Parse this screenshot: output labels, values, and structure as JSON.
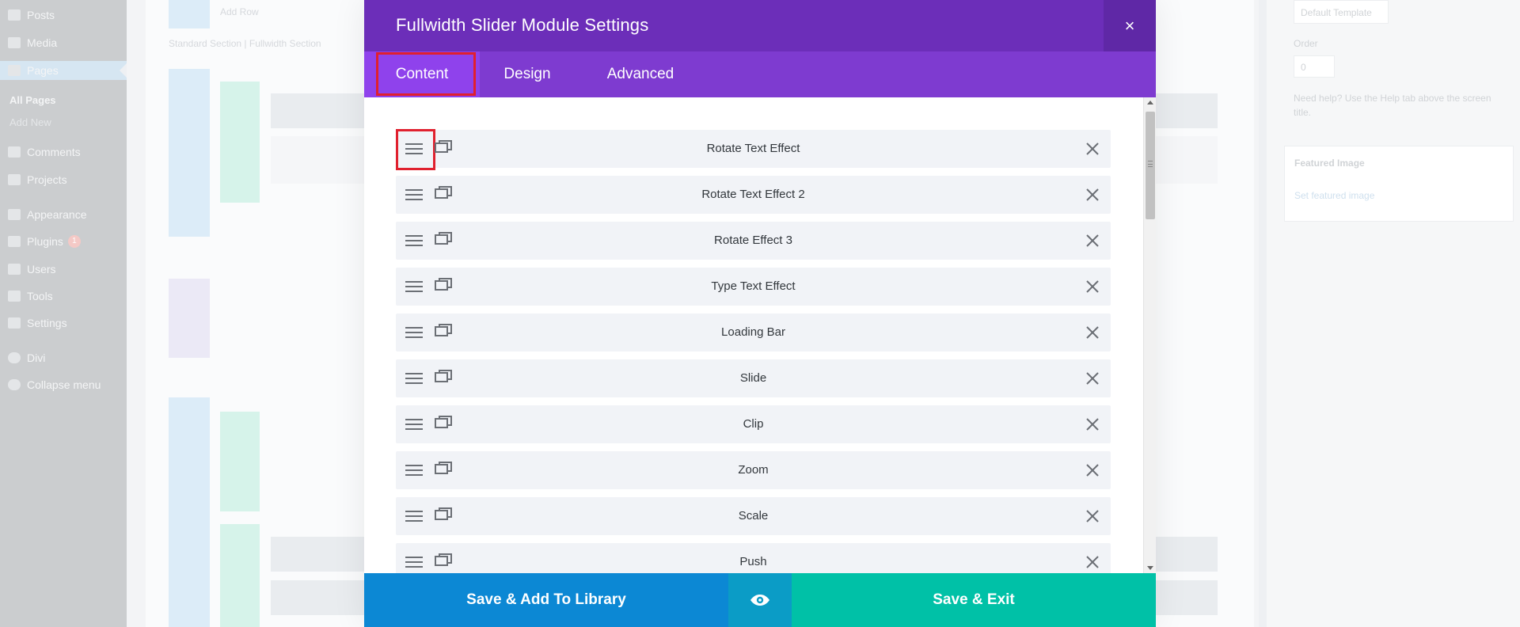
{
  "sidebar": {
    "items": [
      {
        "label": "Posts",
        "icon": "pin-icon"
      },
      {
        "label": "Media",
        "icon": "media-icon"
      },
      {
        "label": "Pages",
        "icon": "pages-icon"
      },
      {
        "label": "All Pages"
      },
      {
        "label": "Add New"
      },
      {
        "label": "Comments",
        "icon": "comment-icon"
      },
      {
        "label": "Projects",
        "icon": "pin-icon"
      },
      {
        "label": "Appearance",
        "icon": "brush-icon"
      },
      {
        "label": "Plugins",
        "icon": "plug-icon",
        "badge": "1"
      },
      {
        "label": "Users",
        "icon": "user-icon"
      },
      {
        "label": "Tools",
        "icon": "wrench-icon"
      },
      {
        "label": "Settings",
        "icon": "settings-icon"
      },
      {
        "label": "Divi",
        "icon": "divi-icon"
      },
      {
        "label": "Collapse menu",
        "icon": "collapse-icon"
      }
    ]
  },
  "builder_bg": {
    "add_row": "Add Row",
    "standard_section": "Standard Section",
    "separator": "|",
    "fullwidth_section": "Fullwidth Section"
  },
  "right_panel": {
    "template_value": "Default Template",
    "order_label": "Order",
    "order_value": "0",
    "help_text": "Need help? Use the Help tab above the screen title.",
    "featured_image": "Featured Image",
    "set_featured_image": "Set featured image"
  },
  "modal": {
    "title": "Fullwidth Slider Module Settings",
    "close_symbol": "×",
    "tabs": [
      {
        "label": "Content",
        "active": true
      },
      {
        "label": "Design",
        "active": false
      },
      {
        "label": "Advanced",
        "active": false
      }
    ],
    "slides": [
      {
        "title": "Rotate Text Effect"
      },
      {
        "title": "Rotate Text Effect 2"
      },
      {
        "title": "Rotate Effect 3"
      },
      {
        "title": "Type Text Effect"
      },
      {
        "title": "Loading Bar"
      },
      {
        "title": "Slide"
      },
      {
        "title": "Clip"
      },
      {
        "title": "Zoom"
      },
      {
        "title": "Scale"
      },
      {
        "title": "Push"
      }
    ],
    "footer": {
      "save_library_label": "Save & Add To Library",
      "preview_icon": "eye-icon",
      "save_exit_label": "Save & Exit"
    }
  },
  "colors": {
    "header": "#6c2eb9",
    "tabs_bar": "#7e3bd0",
    "active_tab": "#8f42ec",
    "highlight": "#e0202e",
    "save_library": "#0c88d4",
    "preview": "#0b9cc6",
    "save_exit": "#00c1a7"
  }
}
